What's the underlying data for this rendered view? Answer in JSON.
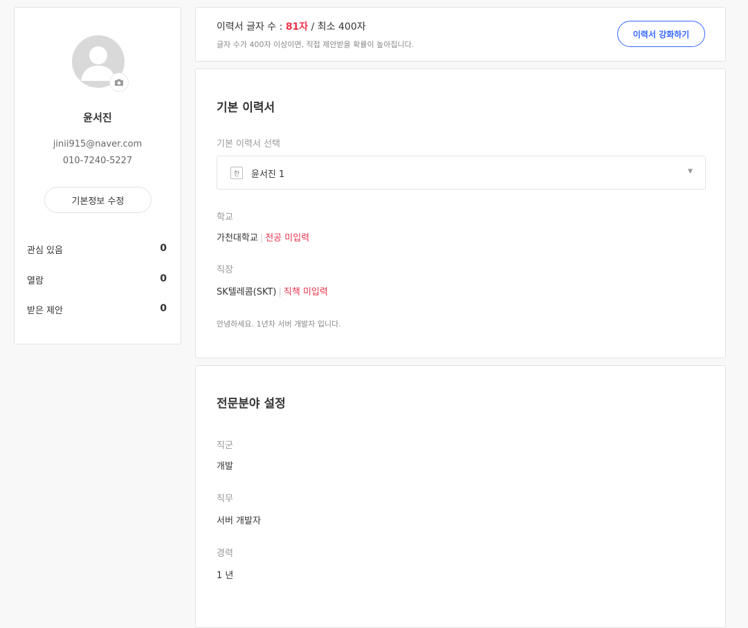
{
  "profile": {
    "name": "윤서진",
    "email": "jinii915@naver.com",
    "phone": "010-7240-5227",
    "edit_label": "기본정보 수정",
    "stats": [
      {
        "label": "관심 있음",
        "value": "0"
      },
      {
        "label": "열람",
        "value": "0"
      },
      {
        "label": "받은 제안",
        "value": "0"
      }
    ]
  },
  "banner": {
    "count_prefix": "이력서 글자 수 :",
    "count_value": "81자",
    "count_suffix": "/ 최소 400자",
    "hint": "글자 수가 400자 이상이면, 직접 제안받을 확률이 높아집니다.",
    "button_label": "이력서 강화하기"
  },
  "resume": {
    "title": "기본 이력서",
    "select_label": "기본 이력서 선택",
    "select_badge": "한",
    "selected_value": "윤서진 1",
    "school_label": "학교",
    "school_value": "가천대학교",
    "school_missing": "전공 미입력",
    "company_label": "직장",
    "company_value": "SK텔레콤(SKT)",
    "company_missing": "직책 미입력",
    "intro": "안녕하세요. 1년차 서버 개발자 입니다.",
    "separator": "|"
  },
  "expertise": {
    "title": "전문분야 설정",
    "job_group_label": "직군",
    "job_group_value": "개발",
    "job_label": "직무",
    "job_value": "서버 개발자",
    "career_label": "경력",
    "career_value": "1 년"
  },
  "icons": {
    "avatar": "user-placeholder-icon",
    "camera": "camera-icon",
    "dropdown": "caret-down-icon"
  },
  "colors": {
    "accent": "#3366ff",
    "warning": "#e9324b",
    "background": "#f8f8f8"
  }
}
